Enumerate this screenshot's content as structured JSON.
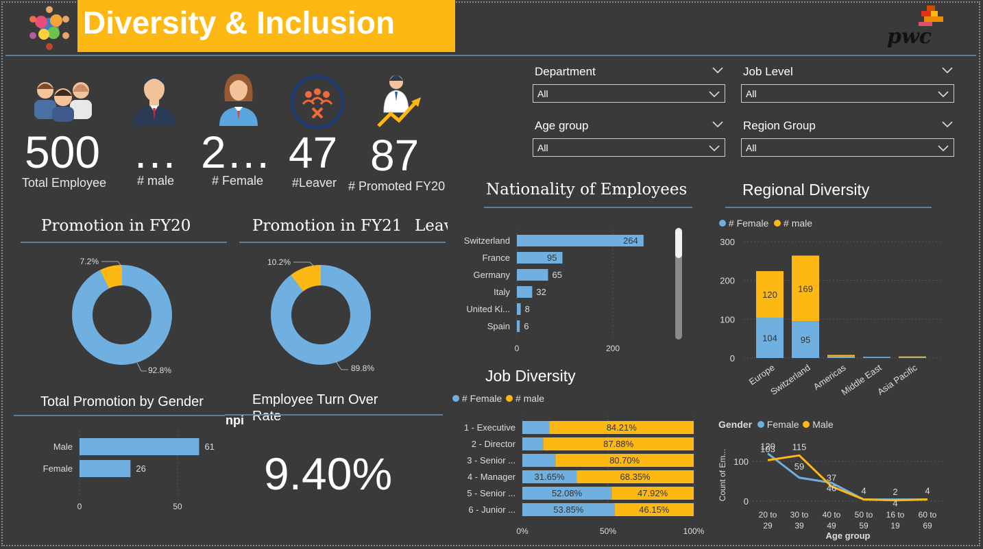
{
  "header": {
    "title": "Diversity & Inclusion",
    "brand": "pwc",
    "logo_icon": "people-circle-logo-icon",
    "colors": {
      "banner": "#fdb813",
      "female": "#6fb0e0",
      "male": "#fdb813",
      "background": "#3a3a3a"
    }
  },
  "kpis": [
    {
      "value": "500",
      "label": "Total Employee",
      "icon": "group-people-icon"
    },
    {
      "value": "…",
      "label": "# male",
      "icon": "man-icon"
    },
    {
      "value": "2…",
      "label": "# Female",
      "icon": "woman-icon"
    },
    {
      "value": "47",
      "label": "#Leaver",
      "icon": "leaver-icon"
    },
    {
      "value": "87",
      "label": "# Promoted FY20",
      "icon": "promotion-icon"
    }
  ],
  "filters": [
    {
      "label": "Department",
      "value": "All"
    },
    {
      "label": "Job Level",
      "value": "All"
    },
    {
      "label": "Age group",
      "value": "All"
    },
    {
      "label": "Region Group",
      "value": "All"
    }
  ],
  "sections": {
    "promo_fy20": "Promotion in FY20",
    "promo_fy21": "Promotion in FY21",
    "leaver_clipped": "Leav",
    "nationality": "Nationality of Employees",
    "regional": "Regional Diversity",
    "job_diversity": "Job Diversity",
    "total_promotion": "Total Promotion by Gender",
    "turnover_title": "Employee Turn Over Rate",
    "turnover_clipped": "npi",
    "turnover_value": "9.40%"
  },
  "legends": {
    "female": "# Female",
    "male": "# male",
    "gender_title": "Gender",
    "gender_female": "Female",
    "gender_male": "Male"
  },
  "chart_data": [
    {
      "id": "promo_fy20",
      "type": "pie",
      "title": "Promotion in FY20",
      "labels": [
        "",
        ""
      ],
      "values": [
        92.8,
        7.2
      ],
      "display": [
        "92.8%",
        "7.2%"
      ]
    },
    {
      "id": "promo_fy21",
      "type": "pie",
      "title": "Promotion in FY21",
      "labels": [
        "",
        ""
      ],
      "values": [
        89.8,
        10.2
      ],
      "display": [
        "89.8%",
        "10.2%"
      ]
    },
    {
      "id": "nationality",
      "type": "bar",
      "orientation": "horizontal",
      "title": "Nationality of Employees",
      "categories": [
        "Switzerland",
        "France",
        "Germany",
        "Italy",
        "United Ki...",
        "Spain"
      ],
      "values": [
        264,
        95,
        65,
        32,
        8,
        6
      ],
      "xlim": [
        0,
        300
      ],
      "xticks": [
        0,
        200
      ]
    },
    {
      "id": "regional",
      "type": "bar",
      "stacked": true,
      "title": "Regional Diversity",
      "categories": [
        "Europe",
        "Switzerland",
        "Americas",
        "Middle East",
        "Asia Pacific"
      ],
      "series": [
        {
          "name": "# Female",
          "values": [
            104,
            95,
            4,
            2,
            1
          ]
        },
        {
          "name": "# male",
          "values": [
            120,
            169,
            4,
            1,
            3
          ]
        }
      ],
      "ylim": [
        0,
        300
      ],
      "yticks": [
        0,
        100,
        200,
        300
      ],
      "legend": "top-left"
    },
    {
      "id": "job_diversity",
      "type": "bar",
      "orientation": "horizontal",
      "stacked": true,
      "percent": true,
      "title": "Job Diversity",
      "categories": [
        "1 - Executive",
        "2 - Director",
        "3 - Senior ...",
        "4 - Manager",
        "5 - Senior ...",
        "6 - Junior ..."
      ],
      "series": [
        {
          "name": "# Female",
          "values": [
            15.79,
            12.12,
            19.3,
            31.65,
            52.08,
            53.85
          ],
          "labels": [
            "",
            "",
            "",
            "31.65%",
            "52.08%",
            "53.85%"
          ]
        },
        {
          "name": "# male",
          "values": [
            84.21,
            87.88,
            80.7,
            68.35,
            47.92,
            46.15
          ],
          "labels": [
            "84.21%",
            "87.88%",
            "80.70%",
            "68.35%",
            "47.92%",
            "46.15%"
          ]
        }
      ],
      "xticks": [
        "0%",
        "50%",
        "100%"
      ],
      "legend": "top-left"
    },
    {
      "id": "total_promotion",
      "type": "bar",
      "orientation": "horizontal",
      "title": "Total Promotion by Gender",
      "categories": [
        "Male",
        "Female"
      ],
      "values": [
        61,
        26
      ],
      "xlim": [
        0,
        75
      ],
      "xticks": [
        0,
        50
      ]
    },
    {
      "id": "age_gender",
      "type": "line",
      "categories": [
        "20 to\n29",
        "30 to\n39",
        "40 to\n49",
        "50 to\n59",
        "16 to\n19",
        "60 to\n69"
      ],
      "series": [
        {
          "name": "Female",
          "values": [
            120,
            59,
            46,
            4,
            4,
            4
          ]
        },
        {
          "name": "Male",
          "values": [
            103,
            115,
            37,
            4,
            2,
            4
          ]
        }
      ],
      "xlabel": "Age group",
      "ylabel": "Count of Em...",
      "ylim": [
        0,
        130
      ],
      "yticks": [
        0,
        100
      ],
      "legend": "top-left"
    }
  ]
}
